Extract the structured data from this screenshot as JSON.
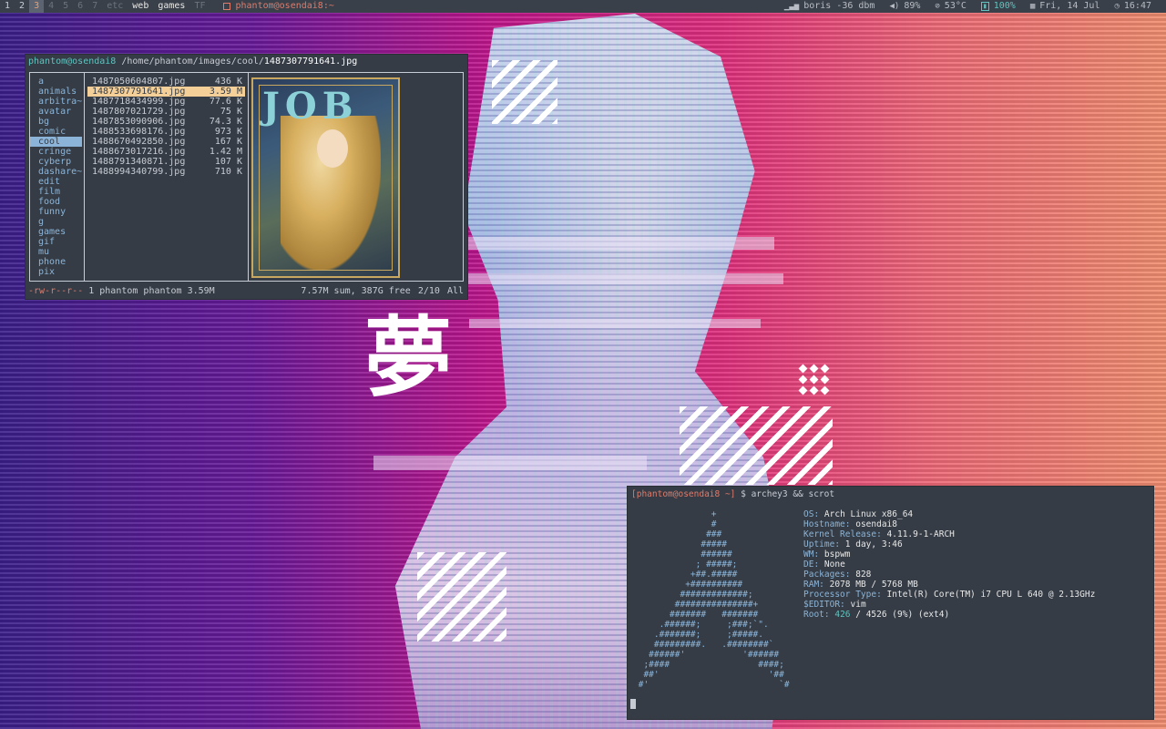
{
  "topbar": {
    "workspaces": [
      "1",
      "2",
      "3",
      "4",
      "5",
      "6",
      "7",
      "etc",
      "web",
      "games",
      "TF"
    ],
    "active_workspace": "3",
    "window_title": "phantom@osendai8:~",
    "wifi": "boris -36 dbm",
    "volume": "89%",
    "temp": "53°C",
    "battery": "100%",
    "date": "Fri, 14 Jul",
    "time": "16:47"
  },
  "art": {
    "kanji": "夢"
  },
  "ranger": {
    "user": "phantom@osendai8",
    "path": "/home/phantom/images/cool/",
    "current_file": "1487307791641.jpg",
    "dirs": [
      "a",
      "animals",
      "arbitra~",
      "avatar",
      "bg",
      "comic",
      "cool",
      "cringe",
      "cyberp",
      "dashare~",
      "edit",
      "film",
      "food",
      "funny",
      "g",
      "games",
      "gif",
      "mu",
      "phone",
      "pix"
    ],
    "selected_dir": "cool",
    "files": [
      {
        "name": "1487050604807.jpg",
        "size": "436 K"
      },
      {
        "name": "1487307791641.jpg",
        "size": "3.59 M"
      },
      {
        "name": "1487718434999.jpg",
        "size": "77.6 K"
      },
      {
        "name": "1487807021729.jpg",
        "size": "75 K"
      },
      {
        "name": "1487853090906.jpg",
        "size": "74.3 K"
      },
      {
        "name": "1488533698176.jpg",
        "size": "973 K"
      },
      {
        "name": "1488670492850.jpg",
        "size": "167 K"
      },
      {
        "name": "1488673017216.jpg",
        "size": "1.42 M"
      },
      {
        "name": "1488791340871.jpg",
        "size": "107 K"
      },
      {
        "name": "1488994340799.jpg",
        "size": "710 K"
      }
    ],
    "selected_file": "1487307791641.jpg",
    "preview_text": "JOB",
    "status": {
      "perms": "-rw-r--r--",
      "owner": "1 phantom phantom 3.59M",
      "sum": "7.57M sum, 387G free",
      "pos": "2/10",
      "all": "All"
    }
  },
  "terminal": {
    "prompt_user": "[phantom@osendai8 ~]",
    "command": "$ archey3 && scrot",
    "ascii_art": [
      "               +",
      "               #",
      "              ###",
      "             #####",
      "             ######",
      "            ; #####;",
      "           +##.#####",
      "          +##########",
      "         #############;",
      "        ###############+",
      "       #######   #######",
      "     .######;     ;###;`\".",
      "    .#######;     ;#####.",
      "    #########.   .########`",
      "   ######'           '######",
      "  ;####                 ####;",
      "  ##'                     '##",
      " #'                         `#"
    ],
    "info": [
      {
        "key": "OS:",
        "value": "Arch Linux x86_64"
      },
      {
        "key": "Hostname:",
        "value": "osendai8"
      },
      {
        "key": "Kernel Release:",
        "value": "4.11.9-1-ARCH"
      },
      {
        "key": "Uptime:",
        "value": "1 day, 3:46"
      },
      {
        "key": "WM:",
        "value": "bspwm"
      },
      {
        "key": "DE:",
        "value": "None"
      },
      {
        "key": "Packages:",
        "value": "828"
      },
      {
        "key": "RAM:",
        "value": "2078 MB / 5768 MB"
      },
      {
        "key": "Processor Type:",
        "value": "Intel(R) Core(TM) i7 CPU       L 640  @ 2.13GHz"
      },
      {
        "key": "$EDITOR:",
        "value": "vim"
      },
      {
        "key": "Root:",
        "value": "/ 4526 (9%) (ext4)",
        "highlight": "426"
      }
    ]
  },
  "colors": {
    "bar_bg": "#3a4049",
    "term_bg": "#353c45",
    "accent_red": "#e07a6a",
    "accent_cyan": "#5ec4c0",
    "accent_blue": "#8cb4d8",
    "selection": "#f4cf98"
  }
}
